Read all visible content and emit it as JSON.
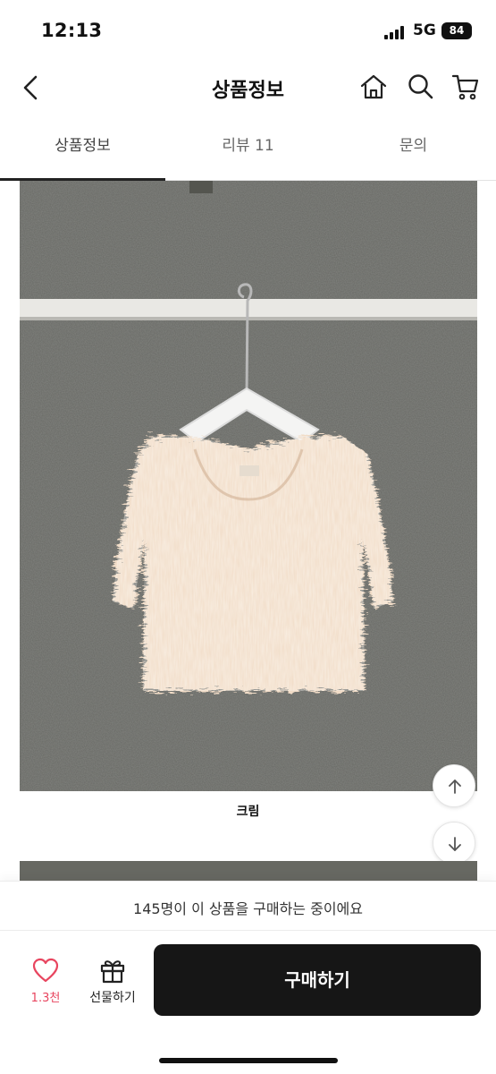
{
  "status_bar": {
    "time": "12:13",
    "network": "5G",
    "battery": "84",
    "icons": [
      "signal-icon",
      "battery-icon"
    ]
  },
  "nav": {
    "title": "상품정보",
    "icons": [
      "back-arrow-icon",
      "home-icon",
      "search-icon",
      "cart-icon"
    ]
  },
  "tabs": [
    {
      "label": "상품정보",
      "active": true
    },
    {
      "label": "리뷰 11",
      "active": false
    },
    {
      "label": "문의",
      "active": false
    }
  ],
  "product": {
    "image": "fluffy cream cropped knit top on white hanger against grey wall",
    "caption": "크림"
  },
  "scroll_buttons": [
    "arrow-up-icon",
    "arrow-down-icon"
  ],
  "promo": {
    "text": "145명이 이 상품을 구매하는 중이에요"
  },
  "bottom_bar": {
    "like_count": "1.3천",
    "gift_label": "선물하기",
    "buy_label": "구매하기"
  },
  "colors": {
    "accent_like": "#e8455f",
    "buy_button": "#161616",
    "photo_background": "#676862"
  }
}
